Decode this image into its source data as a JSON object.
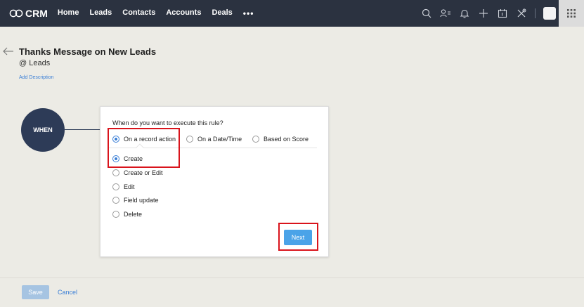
{
  "app": {
    "logo_text": "CRM"
  },
  "nav": {
    "items": [
      {
        "label": "Home"
      },
      {
        "label": "Leads"
      },
      {
        "label": "Contacts"
      },
      {
        "label": "Accounts"
      },
      {
        "label": "Deals"
      }
    ],
    "more_label": "•••"
  },
  "topbar_icons": [
    "search-icon",
    "contacts-icon",
    "bell-icon",
    "plus-icon",
    "calendar-icon",
    "tools-icon",
    "avatar",
    "apps-grid-icon"
  ],
  "header": {
    "title": "Thanks Message on New Leads",
    "module": "@ Leads",
    "add_description": "Add Description"
  },
  "rule": {
    "when_label": "WHEN",
    "question": "When do you want to execute this rule?",
    "trigger_options": [
      {
        "label": "On a record action",
        "checked": true
      },
      {
        "label": "On a Date/Time",
        "checked": false
      },
      {
        "label": "Based on Score",
        "checked": false
      }
    ],
    "action_options": [
      {
        "label": "Create",
        "checked": true
      },
      {
        "label": "Create or Edit",
        "checked": false
      },
      {
        "label": "Edit",
        "checked": false
      },
      {
        "label": "Field update",
        "checked": false
      },
      {
        "label": "Delete",
        "checked": false
      }
    ],
    "next_label": "Next"
  },
  "footer": {
    "save_label": "Save",
    "cancel_label": "Cancel"
  },
  "colors": {
    "topbar": "#2b3240",
    "accent": "#3b7fd6",
    "when_circle": "#2d3b57",
    "highlight": "#d9141c",
    "next_button": "#4aa3e8"
  }
}
